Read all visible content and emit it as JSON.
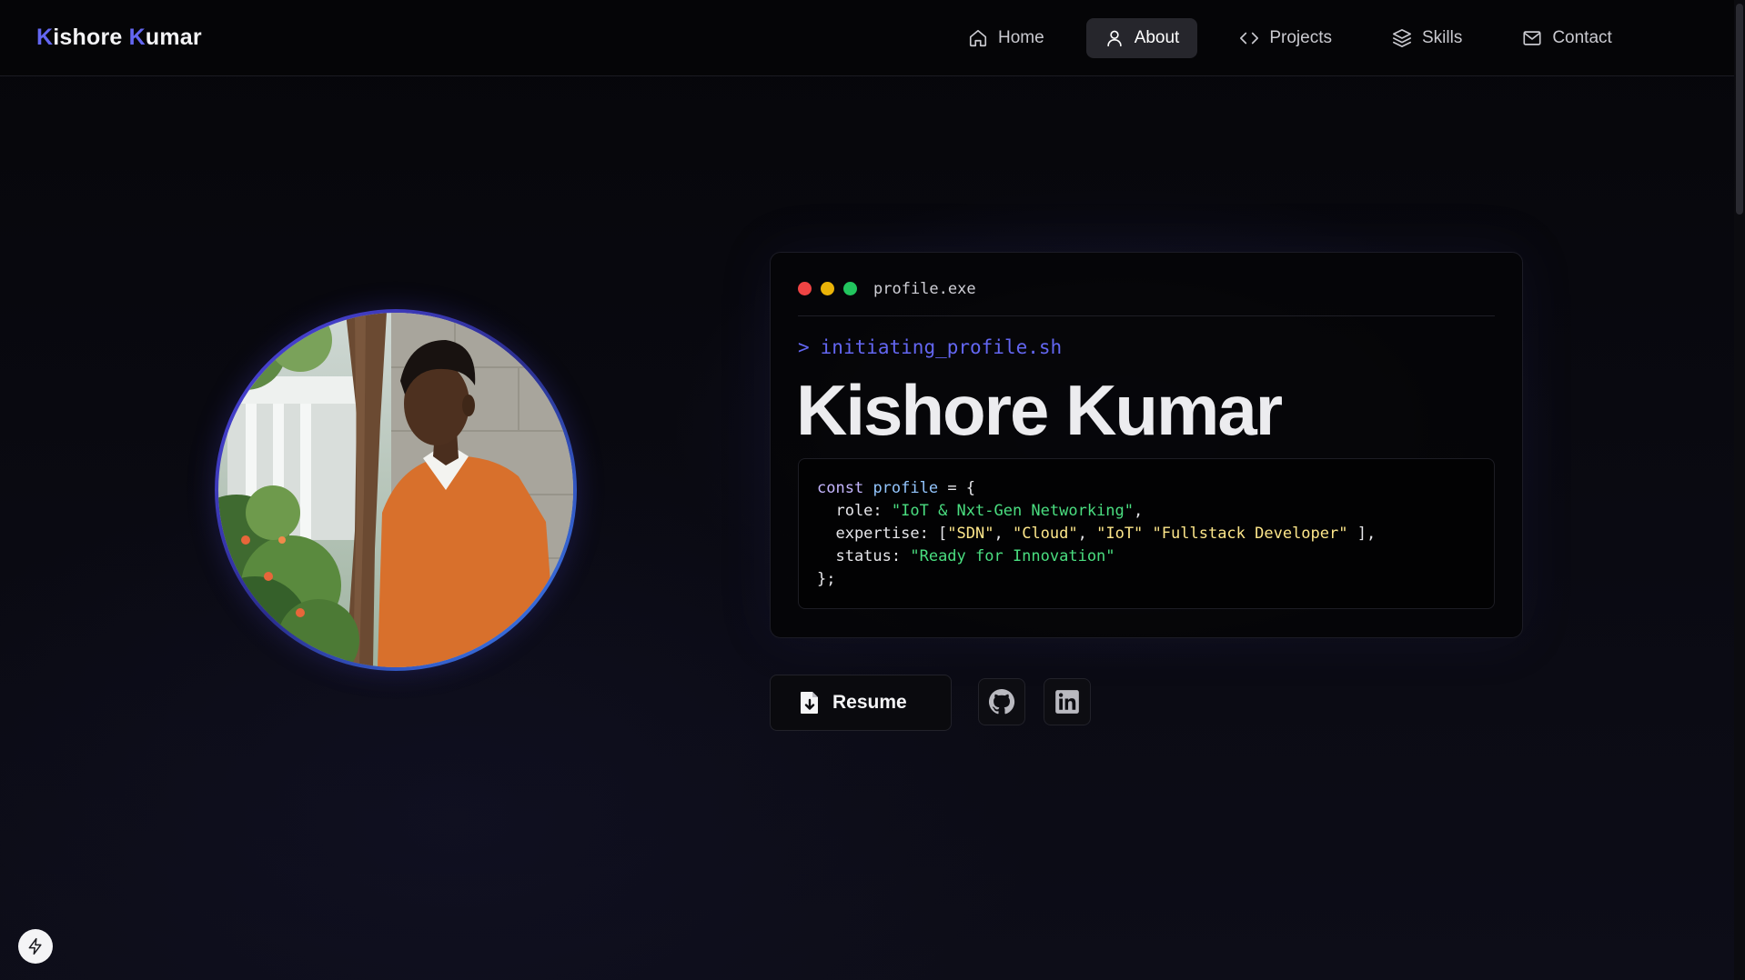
{
  "brand": {
    "first_initial": "K",
    "first_rest": "ishore ",
    "last_initial": "K",
    "last_rest": "umar"
  },
  "nav": {
    "items": [
      {
        "label": "Home",
        "icon": "home-icon"
      },
      {
        "label": "About",
        "icon": "user-icon",
        "active": true
      },
      {
        "label": "Projects",
        "icon": "code-icon"
      },
      {
        "label": "Skills",
        "icon": "layers-icon"
      },
      {
        "label": "Contact",
        "icon": "mail-icon"
      }
    ]
  },
  "terminal": {
    "title": "profile.exe",
    "prompt_symbol": ">",
    "command": "initiating_profile.sh",
    "name": "Kishore Kumar",
    "dot_colors": [
      "#ef4444",
      "#eab308",
      "#22c55e"
    ]
  },
  "code": {
    "line1_kw": "const",
    "line1_var": "profile",
    "line1_rest": " = {",
    "line2_key": "  role: ",
    "line2_val": "\"IoT & Nxt-Gen Networking\"",
    "line2_end": ",",
    "line3_key": "  expertise: [",
    "line3_v1": "\"SDN\"",
    "line3_sep1": ", ",
    "line3_v2": "\"Cloud\"",
    "line3_sep2": ", ",
    "line3_v3": "\"IoT\"",
    "line3_sep3": " ",
    "line3_v4": "\"Fullstack Developer\"",
    "line3_end": " ],",
    "line4_key": "  status: ",
    "line4_val": "\"Ready for Innovation\"",
    "line5": "};"
  },
  "actions": {
    "resume_label": "Resume",
    "github_icon": "github-icon",
    "linkedin_icon": "linkedin-icon"
  },
  "colors": {
    "accent": "#6366f1",
    "background": "#07070c"
  }
}
